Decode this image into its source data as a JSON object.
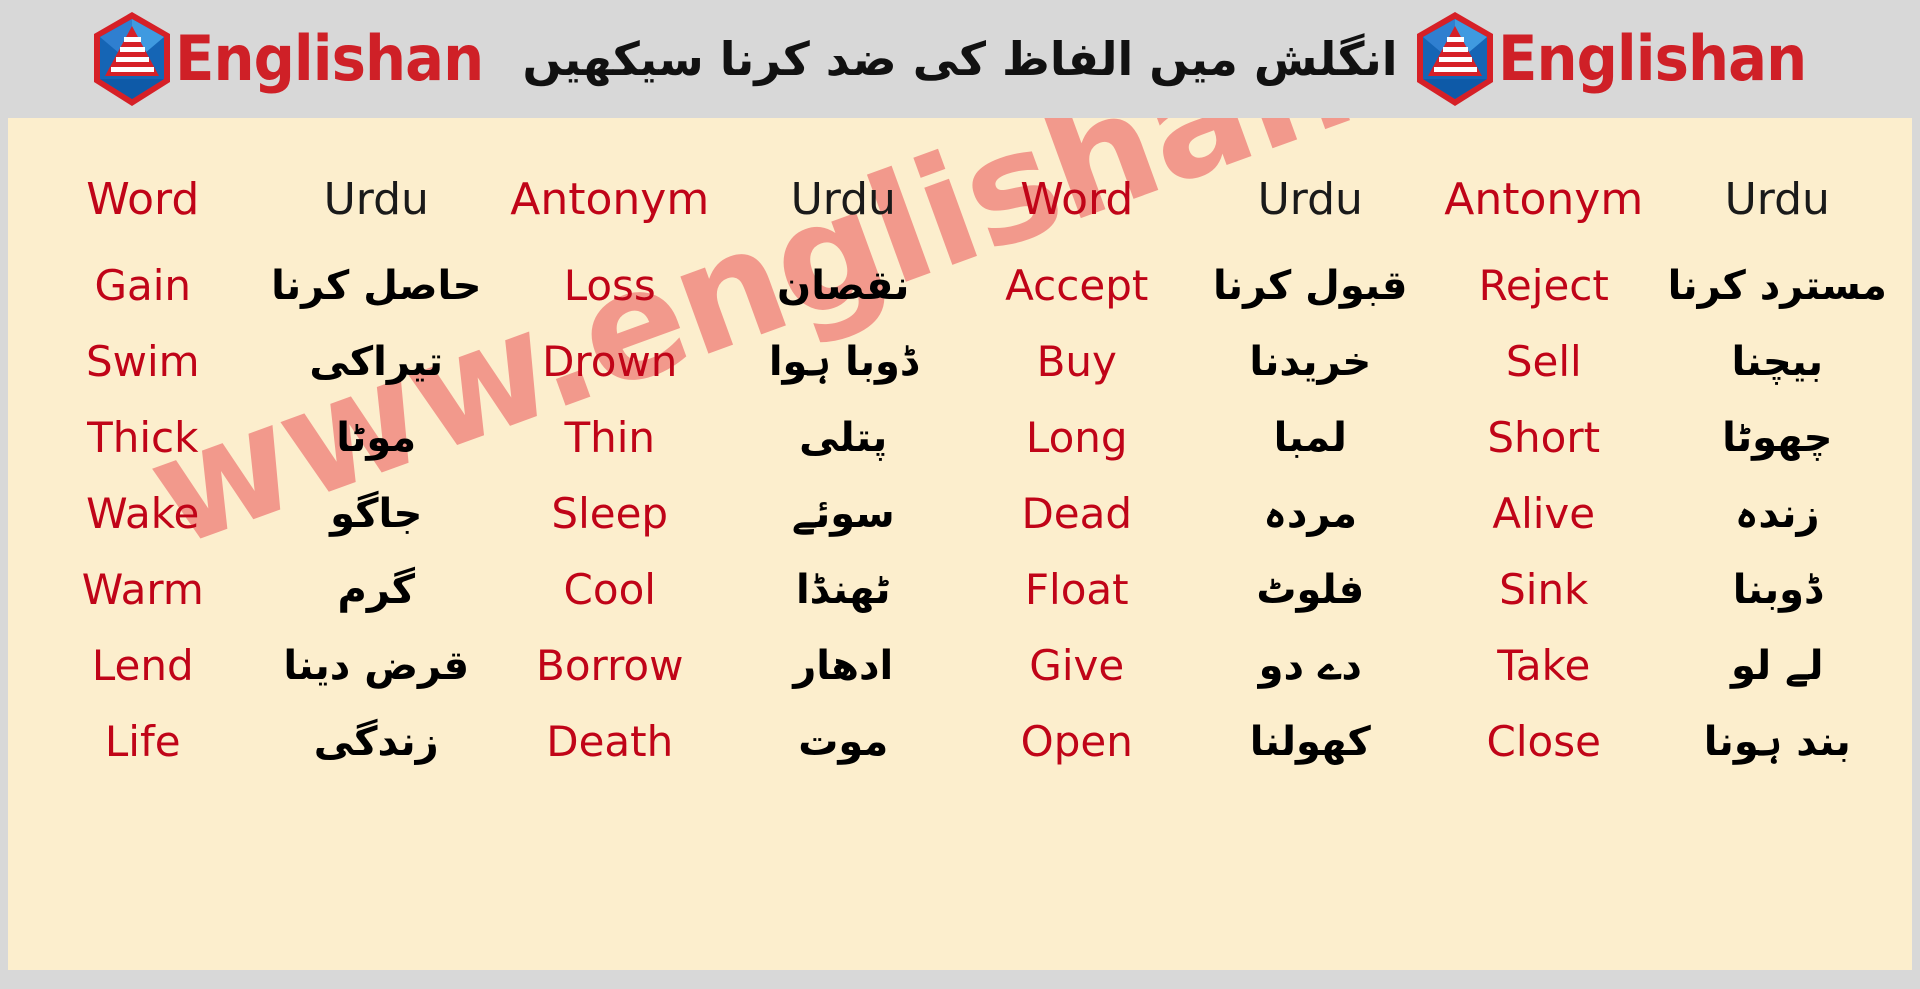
{
  "banner": {
    "title_urdu": "انگلش میں الفاظ کی ضد کرنا سیکھیں",
    "logo_text_left": "Englishan",
    "logo_text_right": "Englishan",
    "brand_red": "#cf2027",
    "brand_blue": "#1f6fc4"
  },
  "watermark": {
    "text": "www.englishan.com",
    "color": "#f2998c"
  },
  "colors": {
    "page_background": "#d8d8d8",
    "table_background": "#fceecd",
    "english_text": "#c00418",
    "urdu_text": "#000000"
  },
  "table": {
    "headers": [
      "Word",
      "Urdu",
      "Antonym",
      "Urdu",
      "Word",
      "Urdu",
      "Antonym",
      "Urdu"
    ],
    "rows": [
      [
        "Gain",
        "حاصل کرنا",
        "Loss",
        "نقصان",
        "Accept",
        "قبول کرنا",
        "Reject",
        "مسترد کرنا"
      ],
      [
        "Swim",
        "تیراکی",
        "Drown",
        "ڈوبا ہوا",
        "Buy",
        "خریدنا",
        "Sell",
        "بیچنا"
      ],
      [
        "Thick",
        "موٹا",
        "Thin",
        "پتلی",
        "Long",
        "لمبا",
        "Short",
        "چھوٹا"
      ],
      [
        "Wake",
        "جاگو",
        "Sleep",
        "سوئے",
        "Dead",
        "مردہ",
        "Alive",
        "زندہ"
      ],
      [
        "Warm",
        "گرم",
        "Cool",
        "ٹھنڈا",
        "Float",
        "فلوٹ",
        "Sink",
        "ڈوبنا"
      ],
      [
        "Lend",
        "قرض دینا",
        "Borrow",
        "ادھار",
        "Give",
        "دے دو",
        "Take",
        "لے لو"
      ],
      [
        "Life",
        "زندگی",
        "Death",
        "موت",
        "Open",
        "کھولنا",
        "Close",
        "بند ہونا"
      ]
    ]
  }
}
